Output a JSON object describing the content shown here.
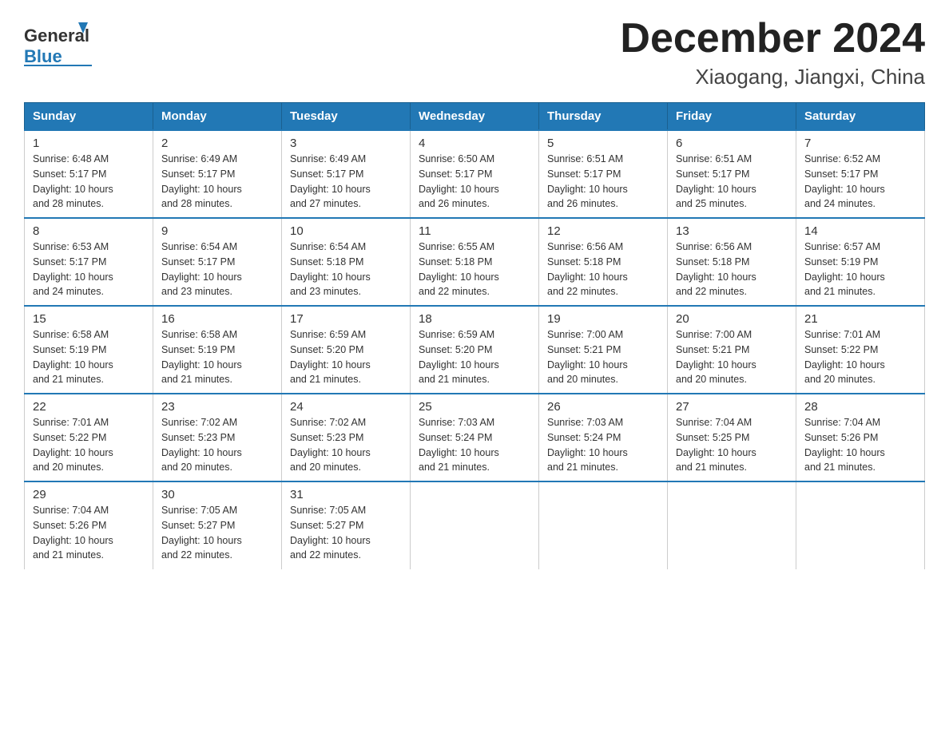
{
  "header": {
    "logo_general": "General",
    "logo_blue": "Blue",
    "title": "December 2024",
    "subtitle": "Xiaogang, Jiangxi, China"
  },
  "days_of_week": [
    "Sunday",
    "Monday",
    "Tuesday",
    "Wednesday",
    "Thursday",
    "Friday",
    "Saturday"
  ],
  "weeks": [
    [
      {
        "day": "1",
        "sunrise": "6:48 AM",
        "sunset": "5:17 PM",
        "daylight": "10 hours and 28 minutes."
      },
      {
        "day": "2",
        "sunrise": "6:49 AM",
        "sunset": "5:17 PM",
        "daylight": "10 hours and 28 minutes."
      },
      {
        "day": "3",
        "sunrise": "6:49 AM",
        "sunset": "5:17 PM",
        "daylight": "10 hours and 27 minutes."
      },
      {
        "day": "4",
        "sunrise": "6:50 AM",
        "sunset": "5:17 PM",
        "daylight": "10 hours and 26 minutes."
      },
      {
        "day": "5",
        "sunrise": "6:51 AM",
        "sunset": "5:17 PM",
        "daylight": "10 hours and 26 minutes."
      },
      {
        "day": "6",
        "sunrise": "6:51 AM",
        "sunset": "5:17 PM",
        "daylight": "10 hours and 25 minutes."
      },
      {
        "day": "7",
        "sunrise": "6:52 AM",
        "sunset": "5:17 PM",
        "daylight": "10 hours and 24 minutes."
      }
    ],
    [
      {
        "day": "8",
        "sunrise": "6:53 AM",
        "sunset": "5:17 PM",
        "daylight": "10 hours and 24 minutes."
      },
      {
        "day": "9",
        "sunrise": "6:54 AM",
        "sunset": "5:17 PM",
        "daylight": "10 hours and 23 minutes."
      },
      {
        "day": "10",
        "sunrise": "6:54 AM",
        "sunset": "5:18 PM",
        "daylight": "10 hours and 23 minutes."
      },
      {
        "day": "11",
        "sunrise": "6:55 AM",
        "sunset": "5:18 PM",
        "daylight": "10 hours and 22 minutes."
      },
      {
        "day": "12",
        "sunrise": "6:56 AM",
        "sunset": "5:18 PM",
        "daylight": "10 hours and 22 minutes."
      },
      {
        "day": "13",
        "sunrise": "6:56 AM",
        "sunset": "5:18 PM",
        "daylight": "10 hours and 22 minutes."
      },
      {
        "day": "14",
        "sunrise": "6:57 AM",
        "sunset": "5:19 PM",
        "daylight": "10 hours and 21 minutes."
      }
    ],
    [
      {
        "day": "15",
        "sunrise": "6:58 AM",
        "sunset": "5:19 PM",
        "daylight": "10 hours and 21 minutes."
      },
      {
        "day": "16",
        "sunrise": "6:58 AM",
        "sunset": "5:19 PM",
        "daylight": "10 hours and 21 minutes."
      },
      {
        "day": "17",
        "sunrise": "6:59 AM",
        "sunset": "5:20 PM",
        "daylight": "10 hours and 21 minutes."
      },
      {
        "day": "18",
        "sunrise": "6:59 AM",
        "sunset": "5:20 PM",
        "daylight": "10 hours and 21 minutes."
      },
      {
        "day": "19",
        "sunrise": "7:00 AM",
        "sunset": "5:21 PM",
        "daylight": "10 hours and 20 minutes."
      },
      {
        "day": "20",
        "sunrise": "7:00 AM",
        "sunset": "5:21 PM",
        "daylight": "10 hours and 20 minutes."
      },
      {
        "day": "21",
        "sunrise": "7:01 AM",
        "sunset": "5:22 PM",
        "daylight": "10 hours and 20 minutes."
      }
    ],
    [
      {
        "day": "22",
        "sunrise": "7:01 AM",
        "sunset": "5:22 PM",
        "daylight": "10 hours and 20 minutes."
      },
      {
        "day": "23",
        "sunrise": "7:02 AM",
        "sunset": "5:23 PM",
        "daylight": "10 hours and 20 minutes."
      },
      {
        "day": "24",
        "sunrise": "7:02 AM",
        "sunset": "5:23 PM",
        "daylight": "10 hours and 20 minutes."
      },
      {
        "day": "25",
        "sunrise": "7:03 AM",
        "sunset": "5:24 PM",
        "daylight": "10 hours and 21 minutes."
      },
      {
        "day": "26",
        "sunrise": "7:03 AM",
        "sunset": "5:24 PM",
        "daylight": "10 hours and 21 minutes."
      },
      {
        "day": "27",
        "sunrise": "7:04 AM",
        "sunset": "5:25 PM",
        "daylight": "10 hours and 21 minutes."
      },
      {
        "day": "28",
        "sunrise": "7:04 AM",
        "sunset": "5:26 PM",
        "daylight": "10 hours and 21 minutes."
      }
    ],
    [
      {
        "day": "29",
        "sunrise": "7:04 AM",
        "sunset": "5:26 PM",
        "daylight": "10 hours and 21 minutes."
      },
      {
        "day": "30",
        "sunrise": "7:05 AM",
        "sunset": "5:27 PM",
        "daylight": "10 hours and 22 minutes."
      },
      {
        "day": "31",
        "sunrise": "7:05 AM",
        "sunset": "5:27 PM",
        "daylight": "10 hours and 22 minutes."
      },
      null,
      null,
      null,
      null
    ]
  ],
  "labels": {
    "sunrise": "Sunrise:",
    "sunset": "Sunset:",
    "daylight": "Daylight:"
  }
}
